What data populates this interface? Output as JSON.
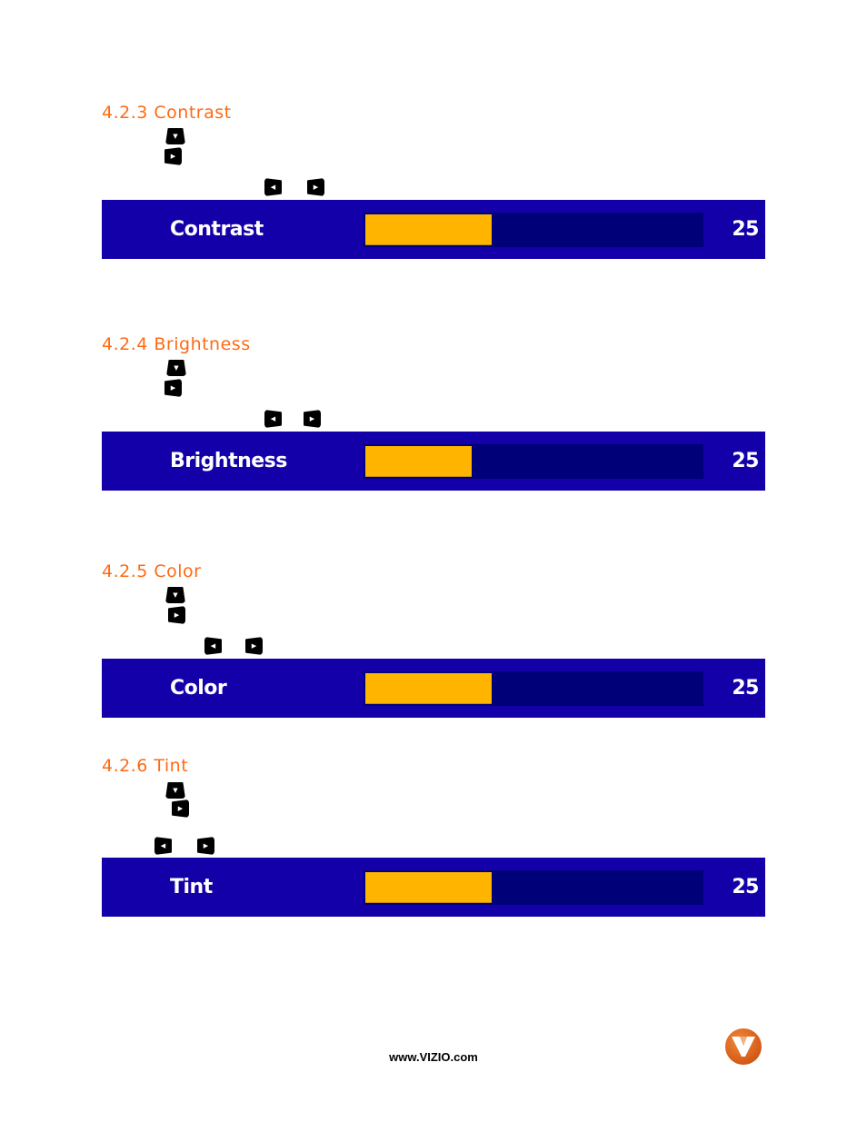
{
  "sections": [
    {
      "heading": "4.2.3 Contrast",
      "osd": {
        "label": "Contrast",
        "value": "25",
        "fill_fraction": 0.377
      }
    },
    {
      "heading": "4.2.4 Brightness",
      "osd": {
        "label": "Brightness",
        "value": "25",
        "fill_fraction": 0.316
      }
    },
    {
      "heading": "4.2.5 Color",
      "osd": {
        "label": "Color",
        "value": "25",
        "fill_fraction": 0.377
      }
    },
    {
      "heading": "4.2.6 Tint",
      "osd": {
        "label": "Tint",
        "value": "25",
        "fill_fraction": 0.377
      }
    }
  ],
  "key_glyphs": {
    "down": "▼",
    "right": "▶",
    "left": "◀"
  },
  "colors": {
    "heading": "#ff6a13",
    "osd_background": "#1400a8",
    "osd_track": "#000078",
    "osd_fill": "#ffb400",
    "osd_text": "#ffffff"
  },
  "footer": {
    "url": "www.VIZIO.com",
    "logo_letter": "V"
  }
}
